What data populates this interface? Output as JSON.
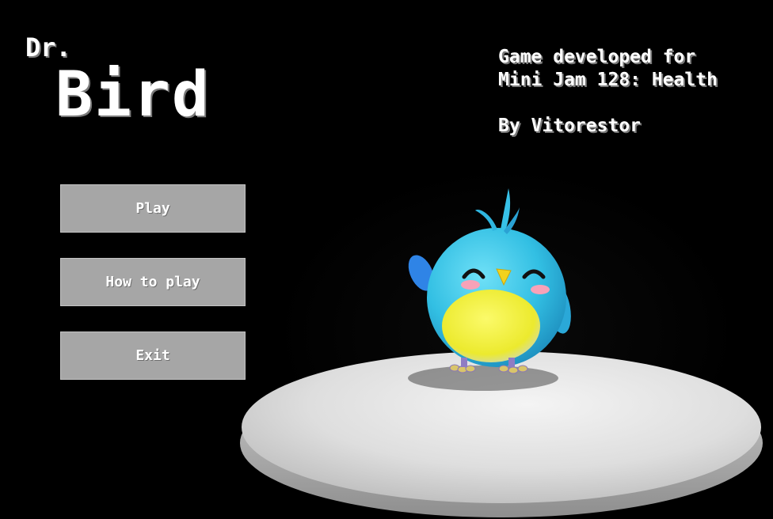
{
  "title": {
    "prefix": "Dr.",
    "main": "Bird"
  },
  "credits": {
    "line1": "Game developed for",
    "line2": "Mini Jam 128: Health",
    "line3": "By Vitorestor"
  },
  "menu": {
    "play_label": "Play",
    "how_to_play_label": "How to play",
    "exit_label": "Exit"
  },
  "colors": {
    "background": "#000000",
    "button": "#a6a6a6",
    "text": "#ffffff",
    "bird_body": "#3cc4e4",
    "bird_belly": "#f2ee3a",
    "pedestal": "#e6e6e6"
  }
}
